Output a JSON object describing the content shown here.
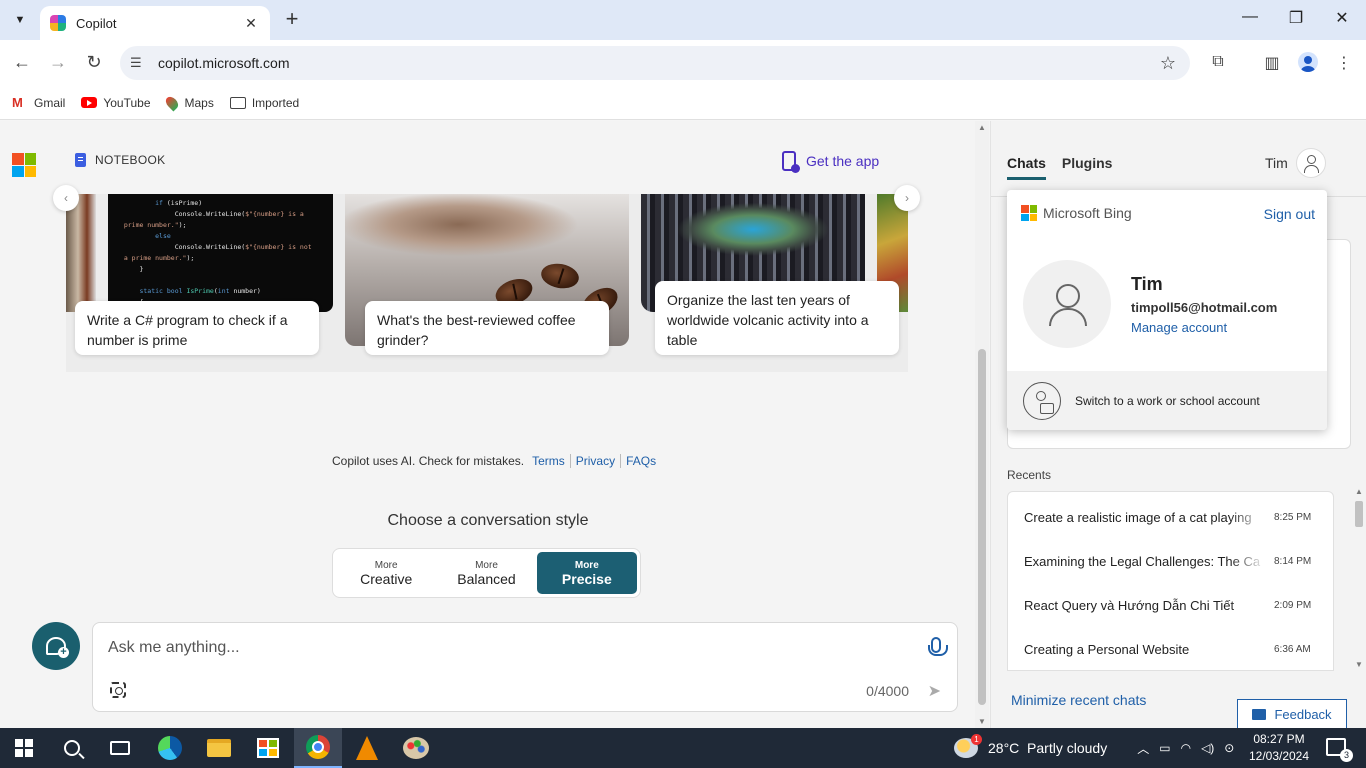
{
  "browser": {
    "tab_title": "Copilot",
    "url": "copilot.microsoft.com",
    "new_tab": "+",
    "bookmarks": [
      {
        "label": "Gmail",
        "icon": "gmail-icon"
      },
      {
        "label": "YouTube",
        "icon": "youtube-icon"
      },
      {
        "label": "Maps",
        "icon": "maps-icon"
      },
      {
        "label": "Imported",
        "icon": "folder-icon"
      }
    ]
  },
  "header": {
    "notebook_label": "NOTEBOOK",
    "get_app_label": "Get the app"
  },
  "suggestions": [
    {
      "text": "Write a C# program to check if a number is prime"
    },
    {
      "text": "What's the best-reviewed coffee grinder?"
    },
    {
      "text": "Organize the last ten years of worldwide volcanic activity into a table"
    }
  ],
  "disclaimer": {
    "text": "Copilot uses AI. Check for mistakes.",
    "links": [
      "Terms",
      "Privacy",
      "FAQs"
    ]
  },
  "conversation_style": {
    "title": "Choose a conversation style",
    "options": [
      {
        "small": "More",
        "big": "Creative",
        "active": false
      },
      {
        "small": "More",
        "big": "Balanced",
        "active": false
      },
      {
        "small": "More",
        "big": "Precise",
        "active": true
      }
    ]
  },
  "chat_input": {
    "placeholder": "Ask me anything...",
    "counter": "0/4000"
  },
  "right_panel": {
    "tabs": [
      "Chats",
      "Plugins"
    ],
    "user_name": "Tim",
    "account_popup": {
      "brand": "Microsoft Bing",
      "sign_out": "Sign out",
      "name": "Tim",
      "email": "timpoll56@hotmail.com",
      "manage": "Manage account",
      "switch": "Switch to a work or school account"
    },
    "recents_label": "Recents",
    "recents": [
      {
        "title": "Create a realistic image of a cat playing",
        "time": "8:25 PM"
      },
      {
        "title": "Examining the Legal Challenges: The Ca",
        "time": "8:14 PM"
      },
      {
        "title": "React Query và Hướng Dẫn Chi Tiết",
        "time": "2:09 PM"
      },
      {
        "title": "Creating a Personal Website",
        "time": "6:36 AM"
      }
    ],
    "minimize_label": "Minimize recent chats",
    "feedback_label": "Feedback"
  },
  "taskbar": {
    "weather": "28°C  Partly cloudy",
    "time": "08:27 PM",
    "date": "12/03/2024",
    "notifications": "3"
  },
  "colors": {
    "accent": "#1c5f73",
    "link": "#1f5fa8",
    "purple": "#4a2fc1",
    "taskbar": "#1f2937"
  }
}
